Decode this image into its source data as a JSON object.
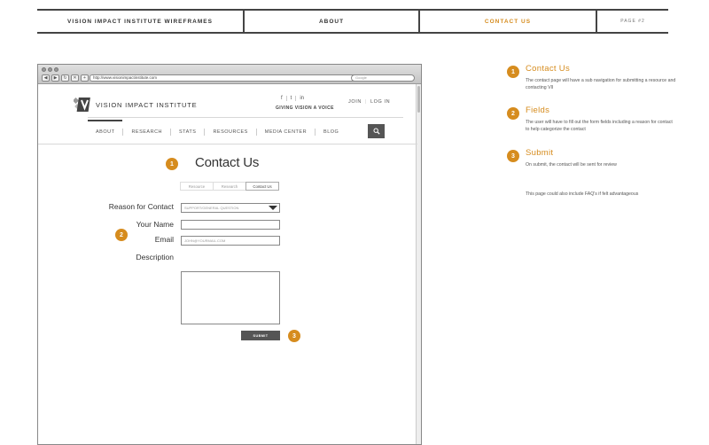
{
  "header": {
    "project": "VISION IMPACT INSTITUTE WIREFRAMES",
    "section_about": "ABOUT",
    "section_contact": "CONTACT US",
    "page": "PAGE #2"
  },
  "browser": {
    "url": "http://www.visionimpactinstitute.com",
    "search_placeholder": "Google"
  },
  "site": {
    "logo_text": "VISION IMPACT INSTITUTE",
    "social": [
      "f",
      "t",
      "in"
    ],
    "tagline": "GIVING VISION A VOICE",
    "join": "JOIN",
    "login": "LOG IN",
    "nav": [
      "ABOUT",
      "RESEARCH",
      "STATS",
      "RESOURCES",
      "MEDIA CENTER",
      "BLOG"
    ]
  },
  "contact": {
    "title": "Contact Us",
    "subtabs": [
      "Resource",
      "Research",
      "Contact Us"
    ],
    "reason_label": "Reason for Contact",
    "reason_value": "SUPPORT/GENERAL QUESTION",
    "name_label": "Your Name",
    "email_label": "Email",
    "email_placeholder": "JOHN@YOURMAIL.COM",
    "description_label": "Description",
    "submit_label": "SUBMIT"
  },
  "badges": {
    "one": "1",
    "two": "2",
    "three": "3"
  },
  "notes": [
    {
      "num": "1",
      "title": "Contact Us",
      "body": "The contact page will have a sub navigation for submitting a resource and contacting VII"
    },
    {
      "num": "2",
      "title": "Fields",
      "body": "The user will have to fill out the form fields including a reason for contact to help categorize the contact"
    },
    {
      "num": "3",
      "title": "Submit",
      "body": "On submit, the contact will be sent for review"
    }
  ],
  "extra_note": "This page could also include FAQ's if felt advantageous",
  "colors": {
    "accent": "#d68c1e",
    "button": "#555555"
  }
}
